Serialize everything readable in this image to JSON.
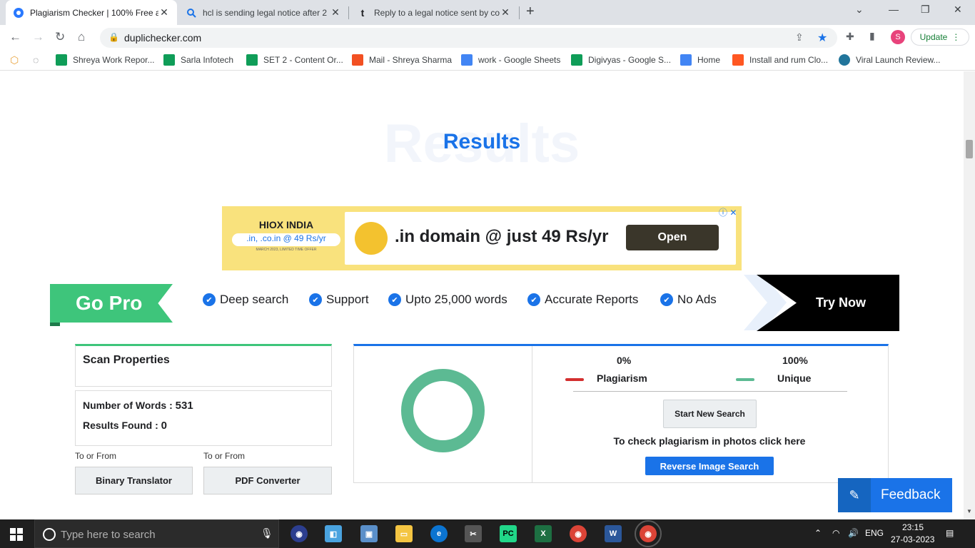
{
  "browser": {
    "tabs": [
      {
        "title": "Plagiarism Checker | 100% Free a",
        "active": true
      },
      {
        "title": "hcl is sending legal notice after 2",
        "active": false
      },
      {
        "title": "Reply to a legal notice sent by co",
        "active": false
      }
    ],
    "url": "duplichecker.com",
    "update_label": "Update",
    "profile_initial": "S"
  },
  "bookmarks": [
    {
      "label": "Shreya Work Repor...",
      "color": "#0f9d58"
    },
    {
      "label": "Sarla Infotech",
      "color": "#0f9d58"
    },
    {
      "label": "SET 2 - Content Or...",
      "color": "#0f9d58"
    },
    {
      "label": "Mail - Shreya Sharma",
      "color": "#f25022"
    },
    {
      "label": "work - Google Sheets",
      "color": "#4285f4"
    },
    {
      "label": "Digivyas - Google S...",
      "color": "#0f9d58"
    },
    {
      "label": "Home",
      "color": "#4285f4"
    },
    {
      "label": "Install and rum Clo...",
      "color": "#ff5722"
    },
    {
      "label": "Viral Launch Review...",
      "color": "#21759b"
    }
  ],
  "page": {
    "ghost_text": "Results",
    "title": "Results",
    "ad": {
      "brand": "HIOX INDIA",
      "offer_pill": ".in, .co.in @ 49 Rs/yr",
      "offer_small": "MARCH 2023, LIMITED TIME OFFER",
      "headline": ".in domain @ just 49 Rs/yr",
      "cta": "Open"
    },
    "gopro": {
      "label": "Go Pro",
      "features": [
        "Deep search",
        "Support",
        "Upto 25,000 words",
        "Accurate Reports",
        "No Ads"
      ],
      "cta": "Try Now"
    },
    "scan": {
      "heading": "Scan Properties",
      "words_label": "Number of Words :",
      "words_value": "531",
      "results_label": "Results Found :",
      "results_value": "0"
    },
    "converters": [
      {
        "caption": "To or From",
        "label": "Binary Translator"
      },
      {
        "caption": "To or From",
        "label": "PDF Converter"
      }
    ],
    "result": {
      "plagiarism_pct": "0%",
      "plagiarism_label": "Plagiarism",
      "unique_pct": "100%",
      "unique_label": "Unique",
      "unique_fraction": 1.0,
      "new_search": "Start New Search",
      "photos_text": "To check plagiarism in photos click here",
      "reverse_button": "Reverse Image Search"
    },
    "feedback": "Feedback"
  },
  "taskbar": {
    "search_placeholder": "Type here to search",
    "lang": "ENG",
    "time": "23:15",
    "date": "27-03-2023"
  },
  "colors": {
    "accent": "#1a73e8",
    "green": "#3ec57b",
    "plagiarism": "#d32f2f",
    "unique": "#5cba93"
  }
}
